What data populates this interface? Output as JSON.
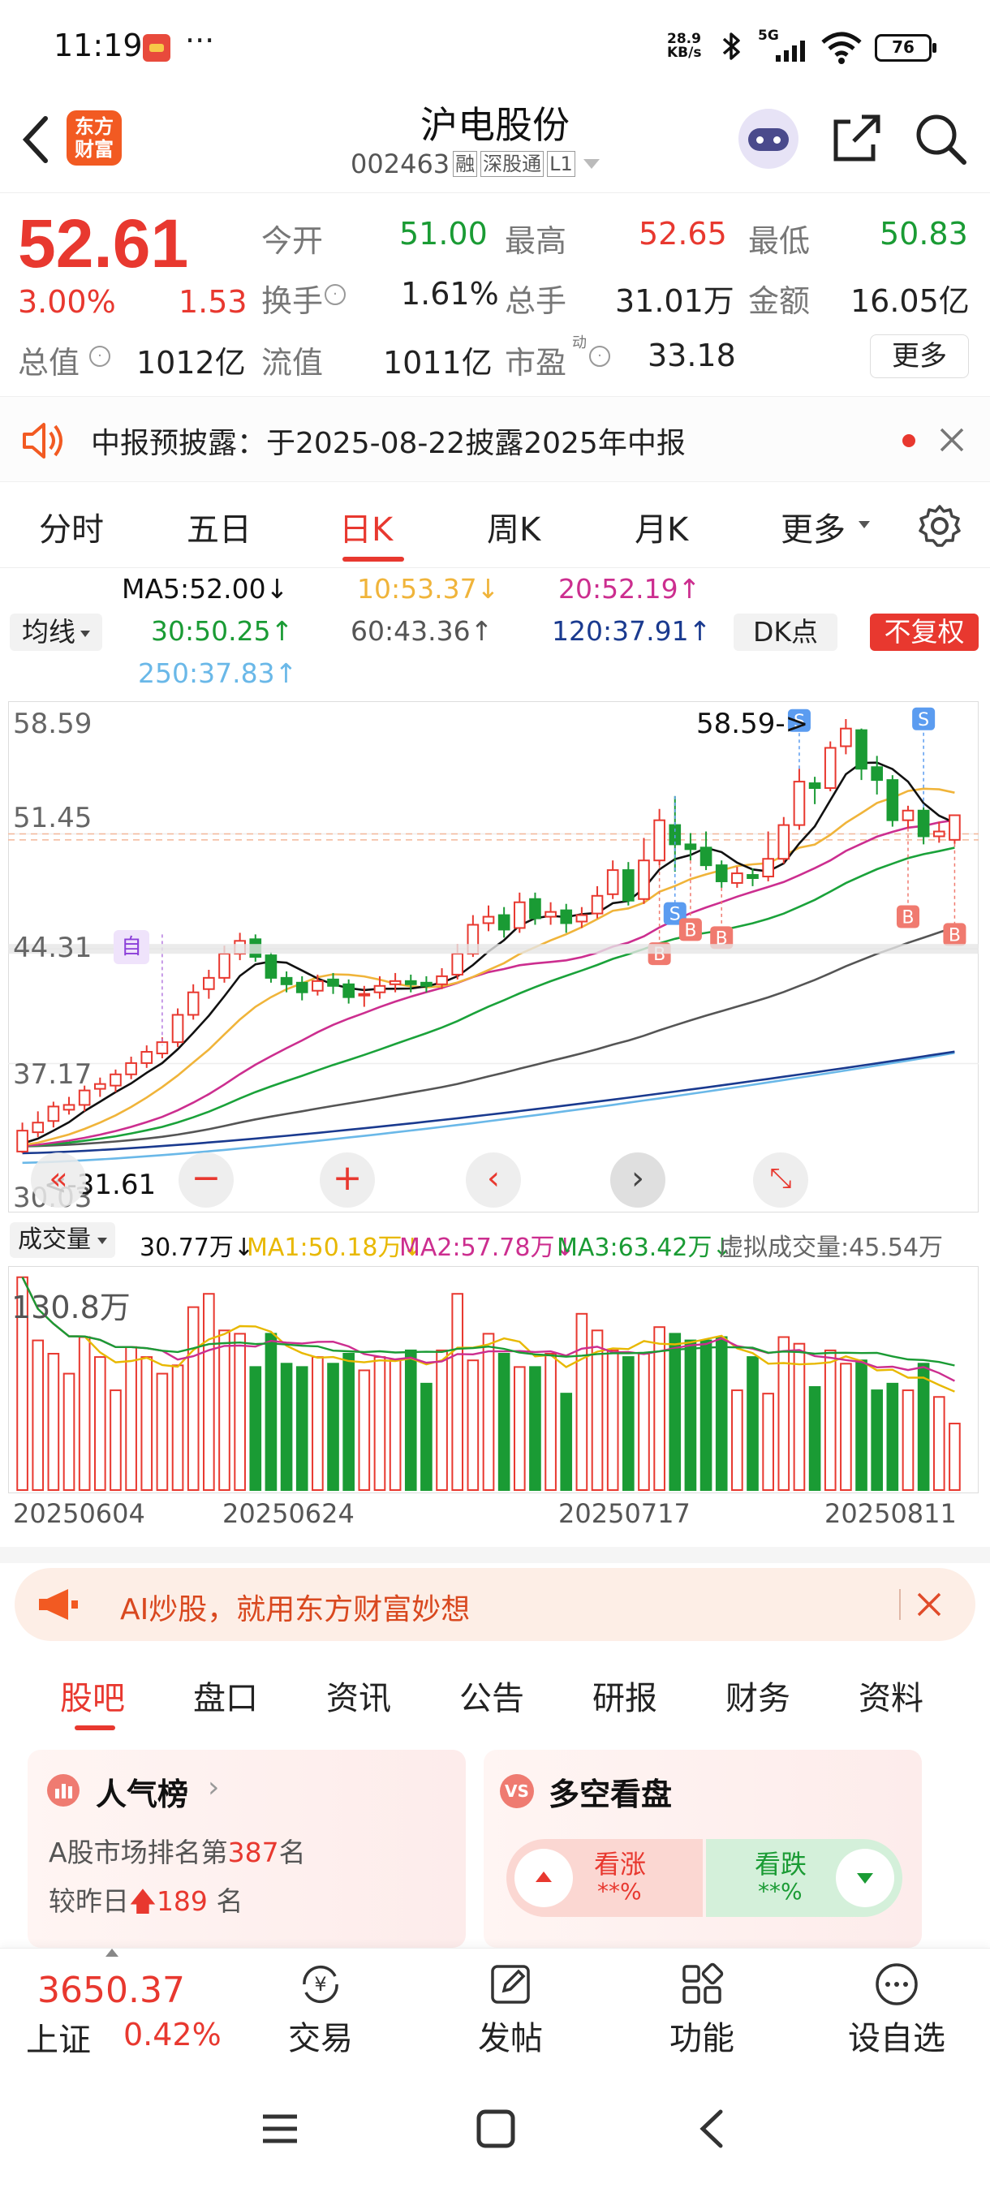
{
  "status_bar": {
    "time": "11:19",
    "net_speed_top": "28.9",
    "net_speed_bottom": "KB/s",
    "signal": "5G",
    "battery": "76"
  },
  "header": {
    "logo_line1": "东方",
    "logo_line2": "财富",
    "title": "沪电股份",
    "code": "002463",
    "tag_rong": "融",
    "tag_sgt": "深股通",
    "tag_l1": "L1"
  },
  "quote": {
    "price": "52.61",
    "change_pct": "3.00%",
    "change_abs": "1.53",
    "rows": [
      [
        {
          "label": "今开",
          "value": "51.00",
          "color": "green"
        },
        {
          "label": "最高",
          "value": "52.65",
          "color": "red"
        },
        {
          "label": "最低",
          "value": "50.83",
          "color": "green"
        }
      ],
      [
        {
          "label": "换手",
          "value": "1.61%",
          "color": "dark"
        },
        {
          "label": "总手",
          "value": "31.01万",
          "color": "dark"
        },
        {
          "label": "金额",
          "value": "16.05亿",
          "color": "dark"
        }
      ]
    ],
    "row3": {
      "zongzhi_label": "总值",
      "zongzhi_value": "1012亿",
      "liuzhi_label": "流值",
      "liuzhi_value": "1011亿",
      "pe_label": "市盈",
      "pe_sup": "动",
      "pe_value": "33.18",
      "more_button": "更多"
    }
  },
  "notice": {
    "text": "中报预披露：于2025-08-22披露2025年中报"
  },
  "period_tabs": [
    "分时",
    "五日",
    "日K",
    "周K",
    "月K",
    "更多"
  ],
  "period_active_index": 2,
  "ma_legend": {
    "indicator_select": "均线",
    "ma5": "MA5:52.00↓",
    "ma10": "10:53.37↓",
    "ma20": "20:52.19↑",
    "ma30": "30:50.25↑",
    "ma60": "60:43.36↑",
    "ma120": "120:37.91↑",
    "ma250": "250:37.83↑",
    "dk_button": "DK点",
    "fq_button": "不复权"
  },
  "kline": {
    "y_labels": [
      "58.59",
      "51.45",
      "44.31",
      "37.17",
      "30.03"
    ],
    "max_marker": "58.59->",
    "min_marker": "<-31.61",
    "self_tag": "自",
    "colors": {
      "up": "#e8382f",
      "down": "#1a9b34",
      "ma5": "#111111",
      "ma10": "#f0b43a",
      "ma20": "#cc2e8f",
      "ma30": "#1aa23a",
      "ma60": "#555555",
      "ma120": "#1a3a8f",
      "ma250": "#6ab8e8"
    }
  },
  "volume_legend": {
    "selector": "成交量",
    "vol": "30.77万↓",
    "ma1": "MA1:50.18万↓",
    "ma2": "MA2:57.78万↓",
    "ma3": "MA3:63.42万↓",
    "virtual": "虚拟成交量:45.54万"
  },
  "volume": {
    "max_label": "130.8万"
  },
  "dates": [
    "20250604",
    "20250624",
    "20250717",
    "20250811"
  ],
  "ai_banner": {
    "text": "AI炒股，就用东方财富妙想"
  },
  "content_tabs": [
    "股吧",
    "盘口",
    "资讯",
    "公告",
    "研报",
    "财务",
    "资料"
  ],
  "content_active_index": 0,
  "popularity": {
    "title": "人气榜",
    "rank_prefix": "A股市场排名第",
    "rank": "387",
    "rank_suffix": "名",
    "change_prefix": "较昨日",
    "change": "189",
    "change_suffix": "名"
  },
  "sentiment": {
    "title": "多空看盘",
    "bull_label": "看涨",
    "bull_value": "**%",
    "bear_label": "看跌",
    "bear_value": "**%"
  },
  "bottom_bar": {
    "index_value": "3650.37",
    "index_name": "上证",
    "index_pct": "0.42%",
    "items": [
      "交易",
      "发帖",
      "功能",
      "设自选"
    ]
  },
  "candles": [
    [
      31.7,
      33.0,
      31.61,
      33.5
    ],
    [
      32.9,
      33.5,
      32.6,
      34.2
    ],
    [
      33.6,
      34.5,
      33.2,
      34.8
    ],
    [
      34.3,
      34.6,
      34.0,
      35.1
    ],
    [
      34.6,
      35.5,
      34.2,
      35.8
    ],
    [
      35.6,
      35.9,
      35.1,
      36.3
    ],
    [
      35.8,
      36.5,
      35.4,
      36.8
    ],
    [
      36.5,
      37.2,
      36.2,
      37.6
    ],
    [
      37.2,
      37.9,
      36.9,
      38.3
    ],
    [
      37.8,
      38.5,
      37.5,
      38.8
    ],
    [
      38.5,
      40.2,
      38.2,
      40.6
    ],
    [
      40.2,
      41.6,
      39.9,
      42.1
    ],
    [
      41.8,
      42.5,
      41.2,
      43.0
    ],
    [
      42.5,
      44.0,
      42.2,
      44.5
    ],
    [
      44.0,
      44.8,
      43.6,
      45.3
    ],
    [
      44.9,
      43.8,
      43.5,
      45.2
    ],
    [
      43.9,
      42.5,
      42.2,
      44.1
    ],
    [
      42.5,
      42.1,
      41.6,
      42.9
    ],
    [
      42.2,
      41.6,
      41.1,
      42.6
    ],
    [
      41.7,
      42.3,
      41.4,
      42.7
    ],
    [
      42.4,
      42.0,
      41.5,
      42.8
    ],
    [
      42.1,
      41.3,
      40.9,
      42.4
    ],
    [
      41.4,
      41.5,
      40.7,
      42.0
    ],
    [
      41.6,
      42.0,
      41.2,
      42.6
    ],
    [
      42.1,
      42.3,
      41.6,
      42.8
    ],
    [
      42.3,
      42.1,
      41.6,
      42.7
    ],
    [
      42.2,
      42.0,
      41.6,
      42.6
    ],
    [
      42.1,
      42.6,
      41.8,
      43.1
    ],
    [
      42.7,
      44.0,
      42.4,
      44.6
    ],
    [
      44.0,
      45.8,
      43.8,
      46.4
    ],
    [
      45.9,
      46.3,
      45.4,
      47.0
    ],
    [
      46.4,
      45.5,
      45.0,
      46.9
    ],
    [
      45.6,
      47.2,
      45.3,
      47.8
    ],
    [
      47.4,
      46.2,
      45.8,
      47.8
    ],
    [
      46.3,
      46.6,
      45.8,
      47.2
    ],
    [
      46.7,
      45.9,
      45.3,
      47.1
    ],
    [
      46.0,
      46.4,
      45.6,
      46.9
    ],
    [
      46.5,
      47.6,
      46.2,
      48.2
    ],
    [
      47.7,
      49.2,
      47.4,
      49.8
    ],
    [
      49.2,
      47.3,
      47.0,
      49.7
    ],
    [
      47.4,
      49.8,
      47.1,
      51.2
    ],
    [
      49.8,
      52.3,
      49.5,
      53.0
    ],
    [
      52.0,
      50.8,
      49.1,
      53.8
    ],
    [
      50.8,
      50.5,
      49.8,
      51.5
    ],
    [
      50.6,
      49.5,
      49.2,
      51.6
    ],
    [
      49.5,
      48.5,
      48.1,
      49.8
    ],
    [
      48.4,
      49.0,
      48.1,
      49.4
    ],
    [
      48.9,
      48.7,
      48.2,
      49.3
    ],
    [
      48.8,
      49.9,
      48.5,
      51.6
    ],
    [
      49.9,
      52.0,
      49.6,
      52.5
    ],
    [
      52.0,
      54.7,
      51.7,
      55.5
    ],
    [
      54.6,
      54.3,
      53.3,
      55.0
    ],
    [
      54.3,
      56.8,
      54.1,
      57.2
    ],
    [
      56.9,
      58.0,
      56.4,
      58.59
    ],
    [
      57.9,
      55.5,
      54.8,
      58.0
    ],
    [
      55.6,
      54.8,
      53.9,
      56.3
    ],
    [
      54.8,
      52.3,
      51.9,
      55.1
    ],
    [
      52.3,
      52.9,
      51.8,
      53.2
    ],
    [
      52.9,
      51.3,
      50.8,
      53.1
    ],
    [
      51.3,
      51.6,
      50.9,
      52.2
    ],
    [
      51.08,
      52.61,
      50.83,
      52.65
    ]
  ],
  "volumes": [
    128,
    90,
    82,
    70,
    92,
    80,
    60,
    86,
    80,
    70,
    75,
    110,
    118,
    96,
    94,
    74,
    94,
    76,
    74,
    80,
    76,
    82,
    72,
    80,
    78,
    84,
    64,
    84,
    118,
    78,
    94,
    82,
    74,
    74,
    82,
    58,
    106,
    96,
    84,
    80,
    82,
    98,
    94,
    90,
    90,
    92,
    60,
    80,
    58,
    92,
    88,
    62,
    84,
    76,
    78,
    60,
    64,
    60,
    76,
    56,
    40
  ]
}
